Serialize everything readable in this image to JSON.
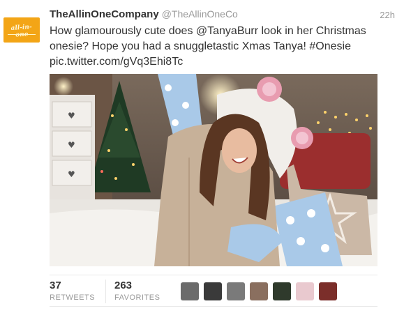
{
  "tweet": {
    "author_name": "TheAllinOneCompany",
    "screen_name": "@TheAllinOneCo",
    "timestamp": "22h",
    "avatar_text": "all-in-one",
    "text_part1": "How glamourously cute does ",
    "mention": "@TanyaBurr",
    "text_part2": " look in her Christmas onesie? Hope you had a snuggletastic Xmas Tanya! ",
    "hashtag": "#Onesie",
    "media_link": "pic.twitter.com/gVq3Ehi8Tc"
  },
  "stats": {
    "retweets_count": "37",
    "retweets_label": "RETWEETS",
    "favorites_count": "263",
    "favorites_label": "FAVORITES"
  },
  "favoriters": [
    {
      "name": "favoriter-avatar-1",
      "color": "#6b6b6b"
    },
    {
      "name": "favoriter-avatar-2",
      "color": "#3a3a3a"
    },
    {
      "name": "favoriter-avatar-3",
      "color": "#7a7a7a"
    },
    {
      "name": "favoriter-avatar-4",
      "color": "#8a6f5f"
    },
    {
      "name": "favoriter-avatar-5",
      "color": "#2f3a2c"
    },
    {
      "name": "favoriter-avatar-6",
      "color": "#e9c9cf"
    },
    {
      "name": "favoriter-avatar-7",
      "color": "#7b2e2a"
    }
  ],
  "colors": {
    "avatar_bg": "#f3a516",
    "text": "#333333",
    "muted": "#999999"
  }
}
